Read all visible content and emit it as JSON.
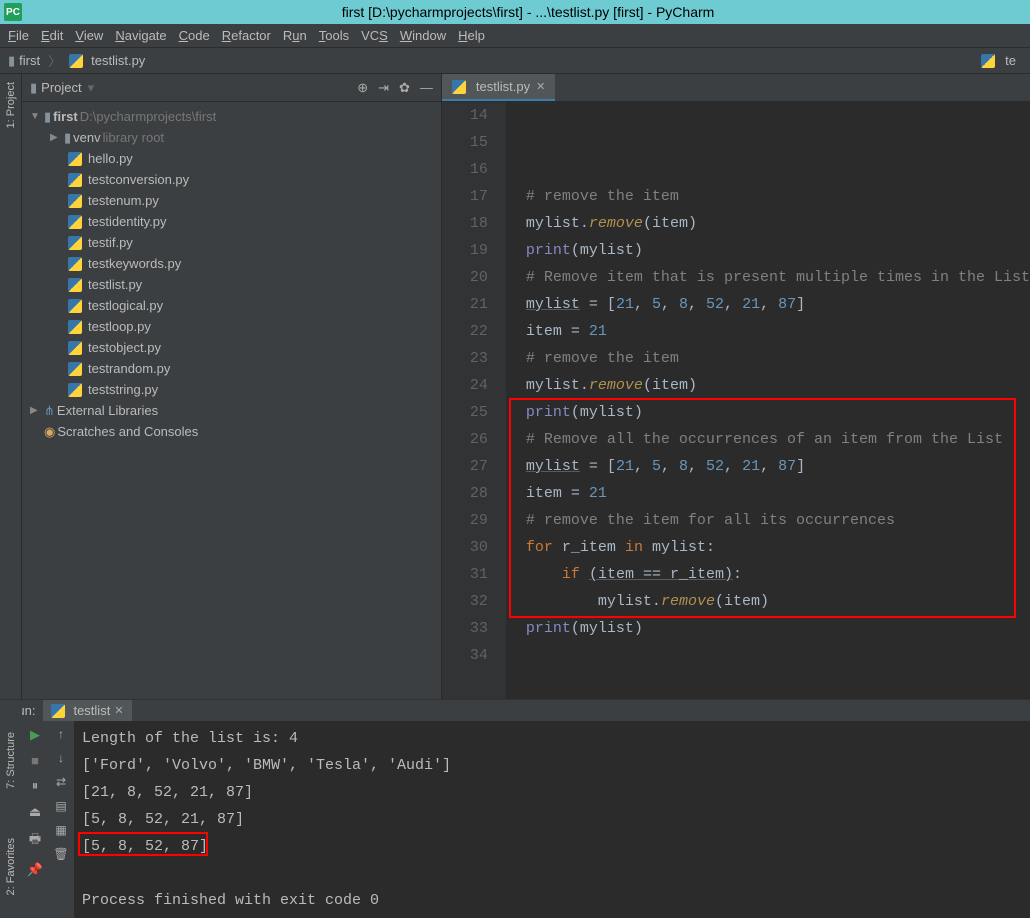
{
  "title": "first [D:\\pycharmprojects\\first] - ...\\testlist.py [first] - PyCharm",
  "menu": [
    "File",
    "Edit",
    "View",
    "Navigate",
    "Code",
    "Refactor",
    "Run",
    "Tools",
    "VCS",
    "Window",
    "Help"
  ],
  "breadcrumb": {
    "proj": "first",
    "file": "testlist.py"
  },
  "nav_right": "te",
  "sidebar": {
    "title": "Project",
    "project": {
      "name": "first",
      "path": "D:\\pycharmprojects\\first"
    },
    "venv": {
      "name": "venv",
      "hint": "library root"
    },
    "files": [
      "hello.py",
      "testconversion.py",
      "testenum.py",
      "testidentity.py",
      "testif.py",
      "testkeywords.py",
      "testlist.py",
      "testlogical.py",
      "testloop.py",
      "testobject.py",
      "testrandom.py",
      "teststring.py"
    ],
    "ext": "External Libraries",
    "scratches": "Scratches and Consoles"
  },
  "rail": {
    "project": "1: Project",
    "structure": "7: Structure",
    "favorites": "2: Favorites"
  },
  "editor": {
    "tab": "testlist.py",
    "lines": [
      {
        "n": 14,
        "t": "c",
        "c": "# remove the item"
      },
      {
        "n": 15,
        "t": "p",
        "c": "mylist.remove(item)"
      },
      {
        "n": 16,
        "t": "pr",
        "c": "print(mylist)"
      },
      {
        "n": 17,
        "t": "p",
        "c": ""
      },
      {
        "n": 18,
        "t": "c",
        "c": "# Remove item that is present multiple times in the List"
      },
      {
        "n": 19,
        "t": "a",
        "c": "mylist = [21, 5, 8, 52, 21, 87]"
      },
      {
        "n": 20,
        "t": "a2",
        "c": "item = 21"
      },
      {
        "n": 21,
        "t": "c",
        "c": "# remove the item"
      },
      {
        "n": 22,
        "t": "p",
        "c": "mylist.remove(item)"
      },
      {
        "n": 23,
        "t": "pr",
        "c": "print(mylist)"
      },
      {
        "n": 24,
        "t": "p",
        "c": ""
      },
      {
        "n": 25,
        "t": "c",
        "c": "# Remove all the occurrences of an item from the List"
      },
      {
        "n": 26,
        "t": "a",
        "c": "mylist = [21, 5, 8, 52, 21, 87]"
      },
      {
        "n": 27,
        "t": "a2",
        "c": "item = 21"
      },
      {
        "n": 28,
        "t": "c",
        "c": "# remove the item for all its occurrences"
      },
      {
        "n": 29,
        "t": "for",
        "c": "for r_item in mylist:"
      },
      {
        "n": 30,
        "t": "if",
        "c": "    if (item == r_item):"
      },
      {
        "n": 31,
        "t": "rm",
        "c": "        mylist.remove(item)"
      },
      {
        "n": 32,
        "t": "pr",
        "c": "print(mylist)"
      },
      {
        "n": 33,
        "t": "p",
        "c": ""
      },
      {
        "n": 34,
        "t": "p",
        "c": ""
      }
    ]
  },
  "run": {
    "label": "Run:",
    "tab": "testlist",
    "output": [
      "Length of the list is: 4",
      "['Ford', 'Volvo', 'BMW', 'Tesla', 'Audi']",
      "[21, 8, 52, 21, 87]",
      "[5, 8, 52, 21, 87]",
      "[5, 8, 52, 87]",
      "",
      "Process finished with exit code 0"
    ]
  }
}
